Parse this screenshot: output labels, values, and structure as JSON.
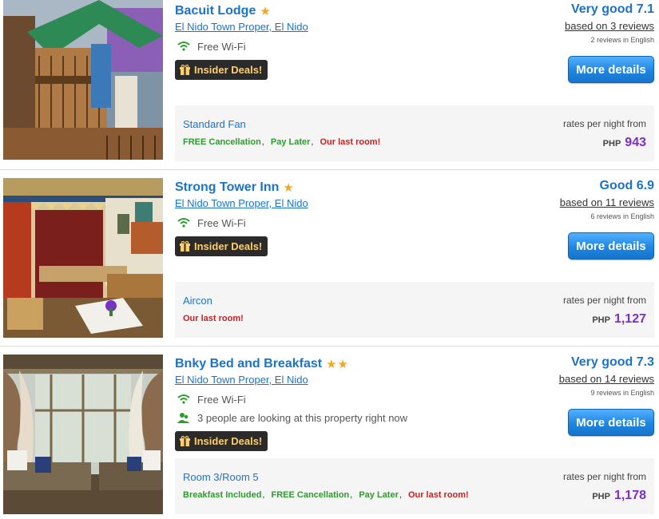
{
  "hotels": [
    {
      "name": "Bacuit Lodge",
      "stars": 1,
      "location": "El Nido Town Proper, El Nido",
      "features": [
        "Free Wi-Fi"
      ],
      "deals_label": "Insider Deals!",
      "score": "Very good 7.1",
      "based_on": "based on 3 reviews",
      "reviews_english": "2 reviews in English",
      "button": "More details",
      "room": "Standard Fan",
      "tags": [
        {
          "label": "FREE Cancellation",
          "color": "green"
        },
        {
          "label": "Pay Later",
          "color": "green"
        },
        {
          "label": "Our last room!",
          "color": "red"
        }
      ],
      "rates_label": "rates per night from",
      "currency": "PHP",
      "price": "943"
    },
    {
      "name": "Strong Tower Inn",
      "stars": 1,
      "location": "El Nido Town Proper, El Nido",
      "features": [
        "Free Wi-Fi"
      ],
      "deals_label": "Insider Deals!",
      "score": "Good 6.9",
      "based_on": "based on 11 reviews",
      "reviews_english": "6 reviews in English",
      "button": "More details",
      "room": "Aircon",
      "tags": [
        {
          "label": "Our last room!",
          "color": "red"
        }
      ],
      "rates_label": "rates per night from",
      "currency": "PHP",
      "price": "1,127"
    },
    {
      "name": "Bnky Bed and Breakfast",
      "stars": 2,
      "location": "El Nido Town Proper, El Nido",
      "features": [
        "Free Wi-Fi",
        "3 people are looking at this property right now"
      ],
      "deals_label": "Insider Deals!",
      "score": "Very good 7.3",
      "based_on": "based on 14 reviews",
      "reviews_english": "9 reviews in English",
      "button": "More details",
      "room": "Room 3/Room 5",
      "tags": [
        {
          "label": "Breakfast Included",
          "color": "green"
        },
        {
          "label": "FREE Cancellation",
          "color": "green"
        },
        {
          "label": "Pay Later",
          "color": "green"
        },
        {
          "label": "Our last room!",
          "color": "red"
        }
      ],
      "rates_label": "rates per night from",
      "currency": "PHP",
      "price": "1,178"
    }
  ],
  "colors": {
    "link": "#1a73c8",
    "price": "#7b2fc8",
    "green_tag": "#2a9d2a",
    "red_tag": "#cc1f1f",
    "star": "#f5a623",
    "deals_bg": "#2b2b2b",
    "deals_text": "#ffcf6b"
  },
  "icons": {
    "star": "star-icon",
    "wifi": "wifi-icon",
    "people": "people-icon",
    "gift": "gift-icon"
  }
}
